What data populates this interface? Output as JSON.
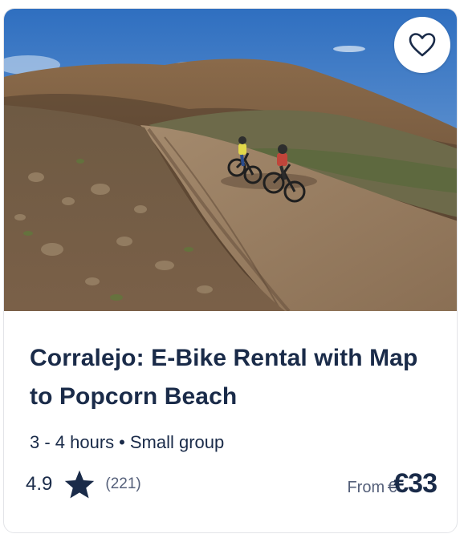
{
  "card": {
    "title": "Corralejo: E-Bike Rental with Map to Popcorn Beach",
    "duration": "3 - 4 hours",
    "separator": "•",
    "group": "Small group",
    "rating": "4.9",
    "reviews": "(221)",
    "price_prefix": "From",
    "currency_symbol_struck": "€",
    "price": "€33",
    "image_alt": "Two cyclists riding e-bikes on a dirt road through volcanic hills",
    "favorite_icon": "heart-icon",
    "star_icon": "star-icon"
  },
  "colors": {
    "title": "#1a2b49",
    "muted": "#55607a",
    "star": "#1a2b49",
    "border": "#e3e4e8"
  }
}
